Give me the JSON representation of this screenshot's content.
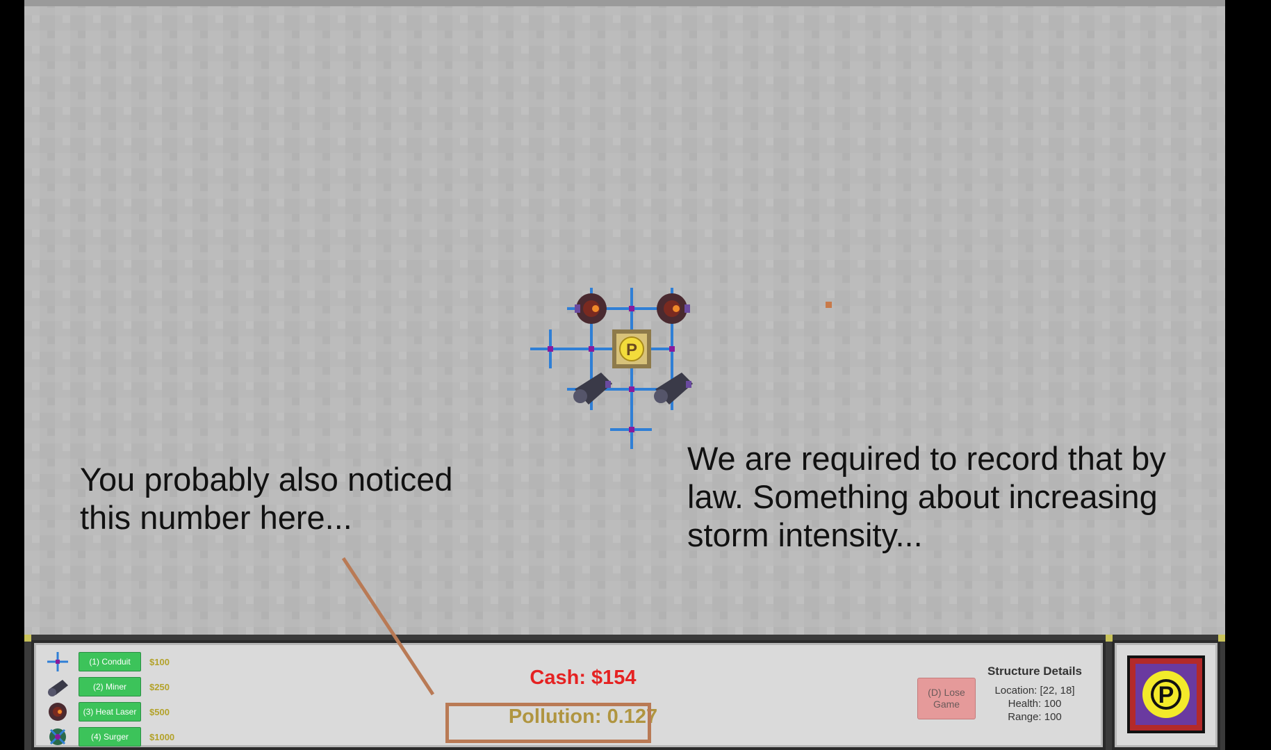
{
  "narration": {
    "left": "You probably also noticed this number here...",
    "right": "We are required to record that by law. Something about increasing storm intensity..."
  },
  "build_menu": [
    {
      "icon": "conduit-icon",
      "label": "(1) Conduit",
      "cost": "$100"
    },
    {
      "icon": "miner-icon",
      "label": "(2) Miner",
      "cost": "$250"
    },
    {
      "icon": "heat-laser-icon",
      "label": "(3) Heat Laser",
      "cost": "$500"
    },
    {
      "icon": "surger-icon",
      "label": "(4) Surger",
      "cost": "$1000"
    }
  ],
  "stats": {
    "cash": "Cash: $154",
    "pollution": "Pollution: 0.127"
  },
  "lose_button": "(D) Lose Game",
  "structure_details": {
    "title": "Structure Details",
    "location": "Location:  [22, 18]",
    "health": "Health:  100",
    "range": "Range:  100"
  },
  "colors": {
    "cash": "#e52222",
    "pollution": "#b09540",
    "callout": "#b97a55",
    "button_green": "#3cc35a",
    "lose_button": "#e59a9a",
    "conduit": "#2f7fd6",
    "node": "#8a1a9a"
  }
}
